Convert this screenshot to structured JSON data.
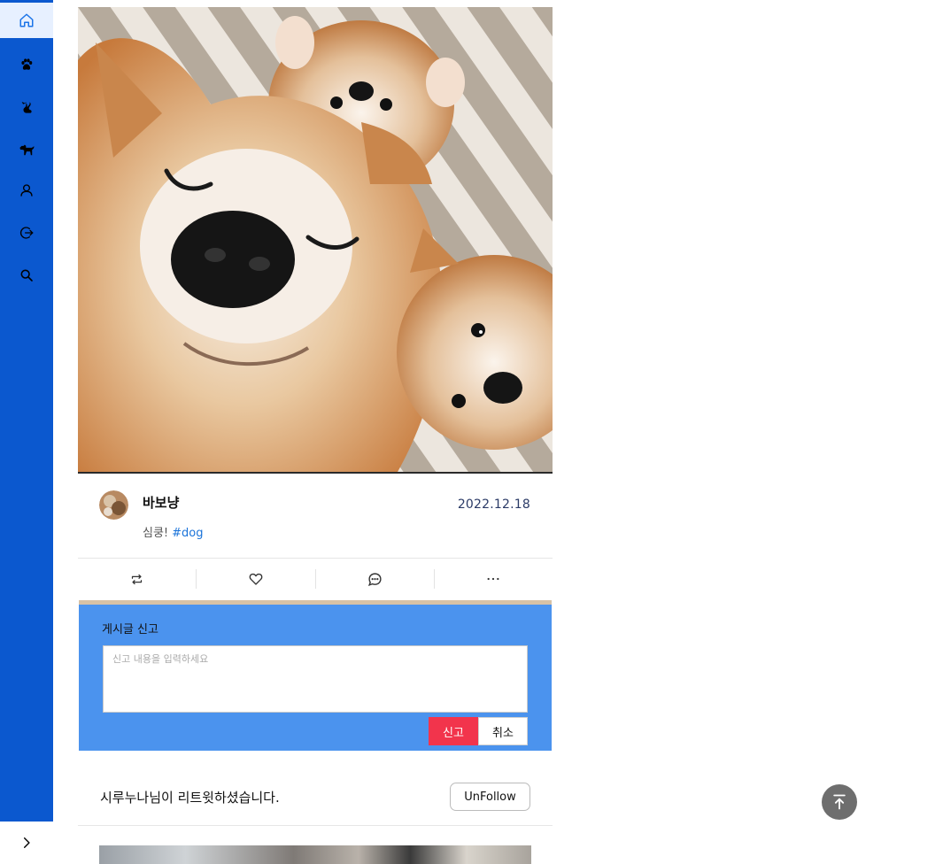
{
  "sidebar": {
    "items": [
      {
        "name": "home",
        "icon": "home-icon",
        "active": true
      },
      {
        "name": "paw",
        "icon": "paw-icon"
      },
      {
        "name": "cat",
        "icon": "cat-icon"
      },
      {
        "name": "dog",
        "icon": "dog-icon"
      },
      {
        "name": "profile",
        "icon": "user-icon"
      },
      {
        "name": "logout",
        "icon": "logout-icon"
      },
      {
        "name": "search",
        "icon": "search-icon"
      }
    ],
    "toggle_icon": "chevron-right-icon",
    "colors": {
      "background": "#0b58cf",
      "active_bg": "#e7f0ff"
    }
  },
  "post": {
    "image_subject": "shiba-inu-dogs-photo",
    "username": "바보냥",
    "date": "2022.12.18",
    "caption_text": "심쿵!",
    "hashtag": "#dog",
    "actions": [
      {
        "name": "retweet",
        "icon": "retweet-icon"
      },
      {
        "name": "like",
        "icon": "heart-icon"
      },
      {
        "name": "comment",
        "icon": "comment-icon"
      },
      {
        "name": "more",
        "icon": "more-icon"
      }
    ]
  },
  "report": {
    "title": "게시글 신고",
    "placeholder": "신고 내용을 입력하세요",
    "value": "",
    "submit_label": "신고",
    "cancel_label": "취소",
    "colors": {
      "panel": "#4b93ee",
      "submit": "#f2344c"
    }
  },
  "retweet_notice": {
    "text": "시루누나님이 리트윗하셨습니다.",
    "unfollow_label": "UnFollow"
  },
  "scroll_top_icon": "arrow-up-to-top-icon"
}
